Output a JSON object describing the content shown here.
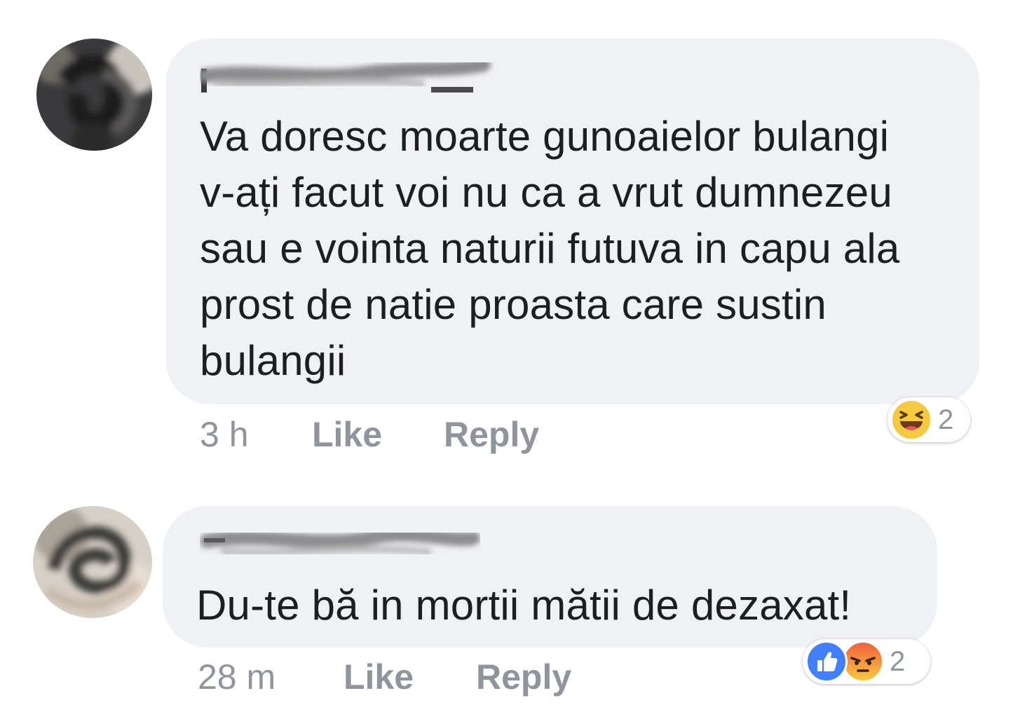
{
  "comments": [
    {
      "text": "Va doresc moarte gunoaielor bulangi\nv-ați facut voi nu ca a vrut dumnezeu\nsau e vointa naturii futuva in capu ala\nprost de natie proasta care sustin\nbulangii",
      "time": "3 h",
      "like_label": "Like",
      "reply_label": "Reply",
      "reactions": [
        "haha-icon"
      ],
      "reaction_count": "2"
    },
    {
      "text": "Du-te bă in mortii mătii de dezaxat!",
      "time": "28 m",
      "like_label": "Like",
      "reply_label": "Reply",
      "reactions": [
        "like-icon",
        "angry-icon"
      ],
      "reaction_count": "2"
    }
  ],
  "colors": {
    "bubble": "#f0f1f4",
    "text": "#1c1e21",
    "meta": "#90949c",
    "like_blue": "#4080ff",
    "haha_yellow": "#f7c940",
    "angry_red": "#f0603c"
  }
}
